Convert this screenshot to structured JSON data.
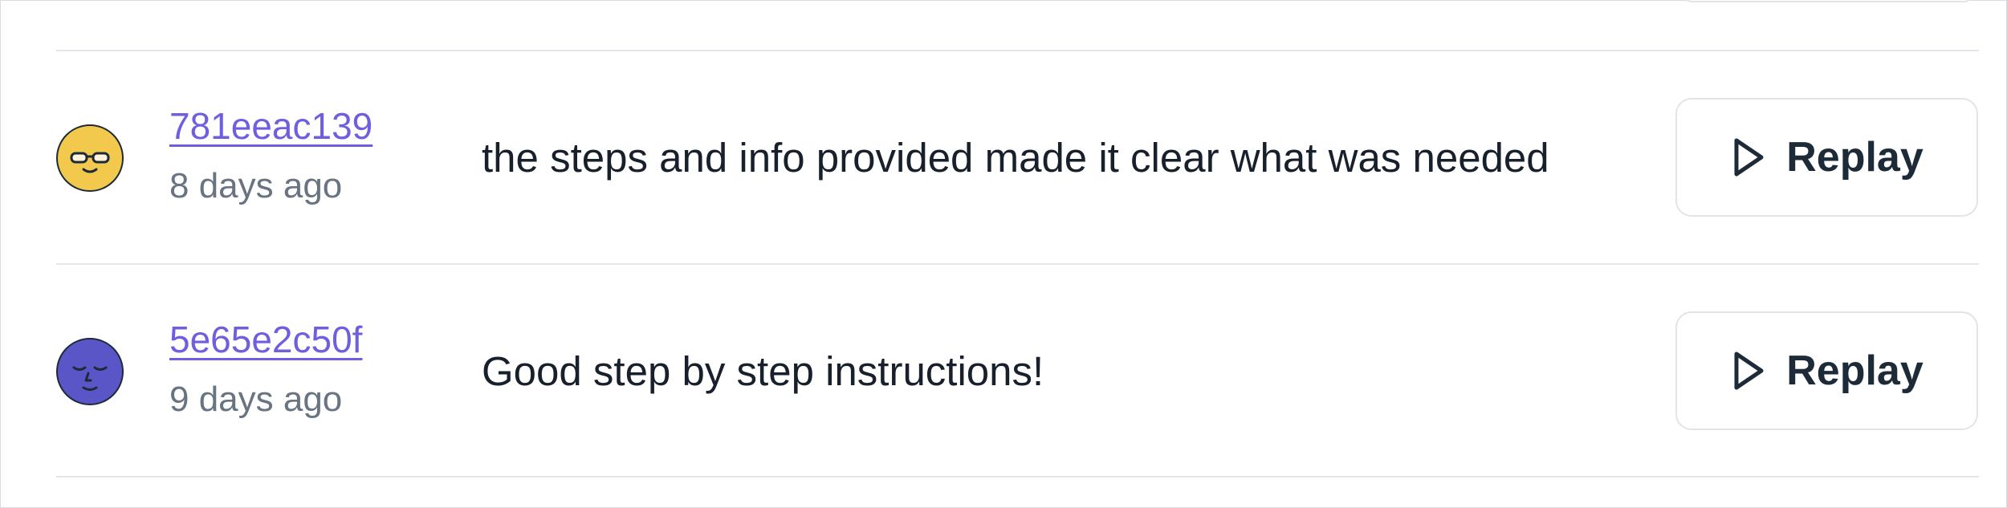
{
  "feedback_list": {
    "items": [
      {
        "user_id": "781eeac139",
        "time_ago": "8 days ago",
        "comment": "the steps and info provided made it clear what was needed",
        "replay_label": "Replay",
        "avatar_icon": "sunglasses-face-icon",
        "avatar_color": "#f2c94c"
      },
      {
        "user_id": "5e65e2c50f",
        "time_ago": "9 days ago",
        "comment": "Good step by step instructions!",
        "replay_label": "Replay",
        "avatar_icon": "sleepy-face-icon",
        "avatar_color": "#5b56c7"
      }
    ]
  }
}
